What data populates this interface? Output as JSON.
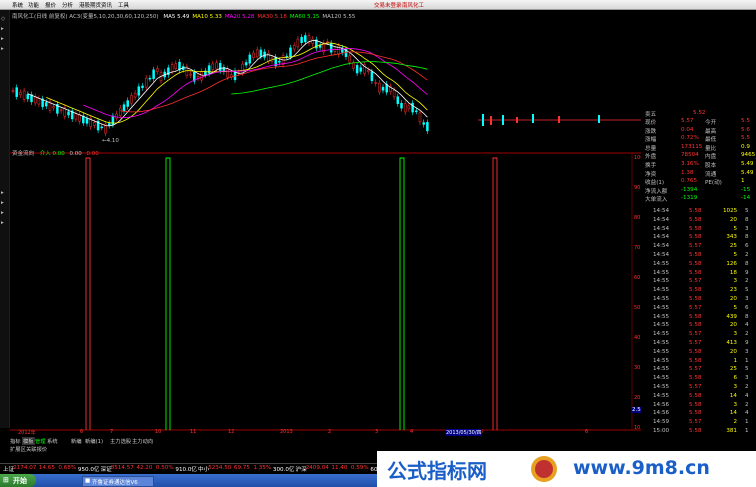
{
  "window": {
    "menu": [
      "系统",
      "功能",
      "报价",
      "分析",
      "港股期货",
      "资讯",
      "工具"
    ],
    "title_right": [
      "交易未登录",
      "南风化工"
    ]
  },
  "main_chart": {
    "legend_prefix": "南风化工(日线 前复权)",
    "legend_indicator": "AC3(变量5,10,20,30,60,120,250)",
    "ma": [
      {
        "label": "MA5",
        "value": "5.49",
        "color": "#ffffff"
      },
      {
        "label": "MA10",
        "value": "5.33",
        "color": "#ffff00"
      },
      {
        "label": "MA20",
        "value": "5.28",
        "color": "#ff00ff"
      },
      {
        "label": "MA30",
        "value": "5.18",
        "color": "#ff3030"
      },
      {
        "label": "MA60",
        "value": "5.15",
        "color": "#00ff00"
      },
      {
        "label": "MA120",
        "value": "5.55",
        "color": "#c0c0c0"
      }
    ],
    "low_label": "4.10"
  },
  "indicator_panel": {
    "title": "资金流向",
    "legend_in_label": "介入",
    "legend_in_value": "0.00",
    "legend_out_value": "0.00",
    "legend_out2_value": "0.00",
    "y_labels": [
      "100.00",
      "90.00",
      "80.00",
      "70.00",
      "60.00",
      "50.00",
      "40.00",
      "30.00",
      "20.00",
      "10.00"
    ],
    "bottom_value": "2.53"
  },
  "date_axis": {
    "labels": [
      "2012年",
      "6",
      "7",
      "10",
      "11",
      "12",
      "2013",
      "2",
      "3",
      "4",
      "5",
      "6"
    ],
    "highlight": "2013/05/30/四"
  },
  "bottom_tabs": {
    "row1": [
      "指标",
      "模板",
      "管理",
      "系统",
      "新编",
      "新编(1)",
      "主力选股",
      "主力动向"
    ],
    "row2": [
      "扩展区",
      "关联报价"
    ]
  },
  "quote": {
    "header": [
      {
        "label": "卖五",
        "value": "5.52"
      }
    ],
    "info_rows": [
      {
        "l1": "现价",
        "v1": "5.57",
        "l2": "今开",
        "v2": "5.5"
      },
      {
        "l1": "涨跌",
        "v1": "0.04",
        "l2": "最高",
        "v2": "5.6"
      },
      {
        "l1": "涨幅",
        "v1": "0.72%",
        "l2": "最低",
        "v2": "5.5"
      },
      {
        "l1": "总量",
        "v1": "173115",
        "l2": "量比",
        "v2": "0.9"
      },
      {
        "l1": "外盘",
        "v1": "78504",
        "l2": "内盘",
        "v2": "9465"
      },
      {
        "l1": "换手",
        "v1": "3.16%",
        "l2": "股本",
        "v2": "5.49"
      },
      {
        "l1": "净资",
        "v1": "1.38",
        "l2": "流通",
        "v2": "5.49"
      },
      {
        "l1": "收益(1)",
        "v1": "0.765",
        "l2": "PE(动)",
        "v2": "1"
      },
      {
        "l1": "净流入额",
        "v1": "-1394",
        "l2": "",
        "v2": "-15"
      },
      {
        "l1": "大单流入",
        "v1": "-1319",
        "l2": "",
        "v2": "-14"
      }
    ],
    "ticks": [
      {
        "t": "14:54",
        "p": "5.58",
        "v": "1025",
        "n": "5"
      },
      {
        "t": "14:54",
        "p": "5.58",
        "v": "20",
        "n": "8"
      },
      {
        "t": "14:54",
        "p": "5.58",
        "v": "5",
        "n": "3"
      },
      {
        "t": "14:54",
        "p": "5.58",
        "v": "343",
        "n": "8"
      },
      {
        "t": "14:54",
        "p": "5.57",
        "v": "25",
        "n": "6"
      },
      {
        "t": "14:54",
        "p": "5.58",
        "v": "5",
        "n": "2"
      },
      {
        "t": "14:55",
        "p": "5.58",
        "v": "126",
        "n": "8"
      },
      {
        "t": "14:55",
        "p": "5.58",
        "v": "18",
        "n": "9"
      },
      {
        "t": "14:55",
        "p": "5.57",
        "v": "3",
        "n": "2"
      },
      {
        "t": "14:55",
        "p": "5.58",
        "v": "23",
        "n": "5"
      },
      {
        "t": "14:55",
        "p": "5.58",
        "v": "20",
        "n": "3"
      },
      {
        "t": "14:55",
        "p": "5.57",
        "v": "5",
        "n": "6"
      },
      {
        "t": "14:55",
        "p": "5.58",
        "v": "439",
        "n": "8"
      },
      {
        "t": "14:55",
        "p": "5.58",
        "v": "20",
        "n": "4"
      },
      {
        "t": "14:55",
        "p": "5.57",
        "v": "3",
        "n": "2"
      },
      {
        "t": "14:55",
        "p": "5.57",
        "v": "413",
        "n": "9"
      },
      {
        "t": "14:55",
        "p": "5.58",
        "v": "20",
        "n": "3"
      },
      {
        "t": "14:55",
        "p": "5.58",
        "v": "1",
        "n": "1"
      },
      {
        "t": "14:55",
        "p": "5.57",
        "v": "25",
        "n": "5"
      },
      {
        "t": "14:55",
        "p": "5.58",
        "v": "6",
        "n": "3"
      },
      {
        "t": "14:55",
        "p": "5.57",
        "v": "3",
        "n": "2"
      },
      {
        "t": "14:55",
        "p": "5.58",
        "v": "14",
        "n": "4"
      },
      {
        "t": "14:56",
        "p": "5.58",
        "v": "3",
        "n": "2"
      },
      {
        "t": "14:56",
        "p": "5.58",
        "v": "14",
        "n": "4"
      },
      {
        "t": "14:59",
        "p": "5.57",
        "v": "2",
        "n": "1"
      },
      {
        "t": "15:00",
        "p": "5.58",
        "v": "381",
        "n": "1"
      }
    ]
  },
  "statusbar": [
    {
      "text": "上证",
      "color": "#ffffff"
    },
    {
      "text": "2174.07",
      "color": "#ff3030"
    },
    {
      "text": "14.65",
      "color": "#ff3030"
    },
    {
      "text": "0.68%",
      "color": "#ff3030"
    },
    {
      "text": "950.0亿",
      "color": "#ffffff"
    },
    {
      "text": "深证",
      "color": "#ffffff"
    },
    {
      "text": "8514.57",
      "color": "#ff3030"
    },
    {
      "text": "42.20",
      "color": "#ff3030"
    },
    {
      "text": "0.50%",
      "color": "#ff3030"
    },
    {
      "text": "910.0亿",
      "color": "#ffffff"
    },
    {
      "text": "中小",
      "color": "#ffffff"
    },
    {
      "text": "5234.50",
      "color": "#ff3030"
    },
    {
      "text": "69.75",
      "color": "#ff3030"
    },
    {
      "text": "1.35%",
      "color": "#ff3030"
    },
    {
      "text": "300.0亿",
      "color": "#ffffff"
    },
    {
      "text": "沪深",
      "color": "#ffffff"
    },
    {
      "text": "2409.04",
      "color": "#ff3030"
    },
    {
      "text": "11.40",
      "color": "#ff3030"
    },
    {
      "text": "0.59%",
      "color": "#ff3030"
    },
    {
      "text": "609.0亿",
      "color": "#ffffff"
    },
    {
      "text": "创业",
      "color": "#ffffff"
    },
    {
      "text": "1367.91",
      "color": "#ff3030"
    }
  ],
  "taskbar": {
    "start": "开始",
    "task": "齐鲁证券通达信V6"
  },
  "watermark": {
    "left": "公式指标网",
    "right": "www.9m8.cn"
  }
}
